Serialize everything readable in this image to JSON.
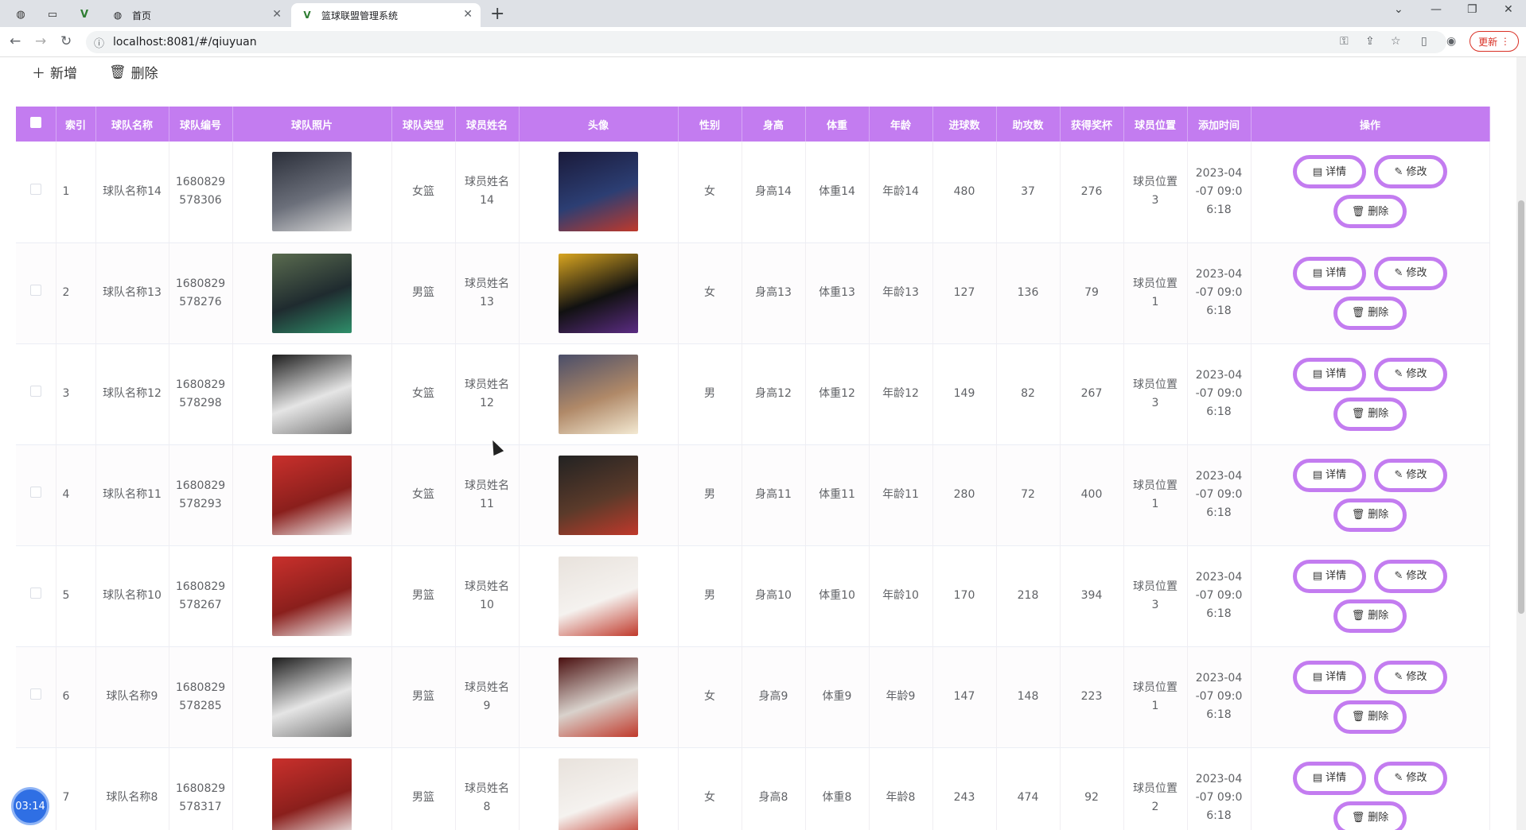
{
  "browser": {
    "tabs": [
      {
        "label": "首页",
        "active": false
      },
      {
        "label": "篮球联盟管理系统",
        "active": true
      }
    ],
    "url": "localhost:8081/#/qiuyuan",
    "update_label": "更新"
  },
  "toolbar": {
    "add_label": "新增",
    "delete_label": "删除"
  },
  "table": {
    "headers": [
      "索引",
      "球队名称",
      "球队编号",
      "球队照片",
      "球队类型",
      "球员姓名",
      "头像",
      "性别",
      "身高",
      "体重",
      "年龄",
      "进球数",
      "助攻数",
      "获得奖杯",
      "球员位置",
      "添加时间",
      "操作"
    ],
    "rows": [
      {
        "index": "1",
        "team_name": "球队名称14",
        "team_no": "1680829578306",
        "team_type": "女篮",
        "player_name": "球员姓名14",
        "gender": "女",
        "height": "身高14",
        "weight": "体重14",
        "age": "年龄14",
        "goals": "480",
        "assists": "37",
        "trophies": "276",
        "position": "球员位置3",
        "added": "2023-04-07 09:06:18"
      },
      {
        "index": "2",
        "team_name": "球队名称13",
        "team_no": "1680829578276",
        "team_type": "男篮",
        "player_name": "球员姓名13",
        "gender": "女",
        "height": "身高13",
        "weight": "体重13",
        "age": "年龄13",
        "goals": "127",
        "assists": "136",
        "trophies": "79",
        "position": "球员位置1",
        "added": "2023-04-07 09:06:18"
      },
      {
        "index": "3",
        "team_name": "球队名称12",
        "team_no": "1680829578298",
        "team_type": "女篮",
        "player_name": "球员姓名12",
        "gender": "男",
        "height": "身高12",
        "weight": "体重12",
        "age": "年龄12",
        "goals": "149",
        "assists": "82",
        "trophies": "267",
        "position": "球员位置3",
        "added": "2023-04-07 09:06:18"
      },
      {
        "index": "4",
        "team_name": "球队名称11",
        "team_no": "1680829578293",
        "team_type": "女篮",
        "player_name": "球员姓名11",
        "gender": "男",
        "height": "身高11",
        "weight": "体重11",
        "age": "年龄11",
        "goals": "280",
        "assists": "72",
        "trophies": "400",
        "position": "球员位置1",
        "added": "2023-04-07 09:06:18"
      },
      {
        "index": "5",
        "team_name": "球队名称10",
        "team_no": "1680829578267",
        "team_type": "男篮",
        "player_name": "球员姓名10",
        "gender": "男",
        "height": "身高10",
        "weight": "体重10",
        "age": "年龄10",
        "goals": "170",
        "assists": "218",
        "trophies": "394",
        "position": "球员位置3",
        "added": "2023-04-07 09:06:18"
      },
      {
        "index": "6",
        "team_name": "球队名称9",
        "team_no": "1680829578285",
        "team_type": "男篮",
        "player_name": "球员姓名9",
        "gender": "女",
        "height": "身高9",
        "weight": "体重9",
        "age": "年龄9",
        "goals": "147",
        "assists": "148",
        "trophies": "223",
        "position": "球员位置1",
        "added": "2023-04-07 09:06:18"
      },
      {
        "index": "7",
        "team_name": "球队名称8",
        "team_no": "1680829578317",
        "team_type": "男篮",
        "player_name": "球员姓名8",
        "gender": "女",
        "height": "身高8",
        "weight": "体重8",
        "age": "年龄8",
        "goals": "243",
        "assists": "474",
        "trophies": "92",
        "position": "球员位置2",
        "added": "2023-04-07 09:06:18"
      }
    ],
    "actions": {
      "detail": "详情",
      "edit": "修改",
      "delete": "删除"
    }
  },
  "timer": "03:14",
  "colors": {
    "accent": "#c37cf0",
    "header_text": "#ffffff"
  }
}
